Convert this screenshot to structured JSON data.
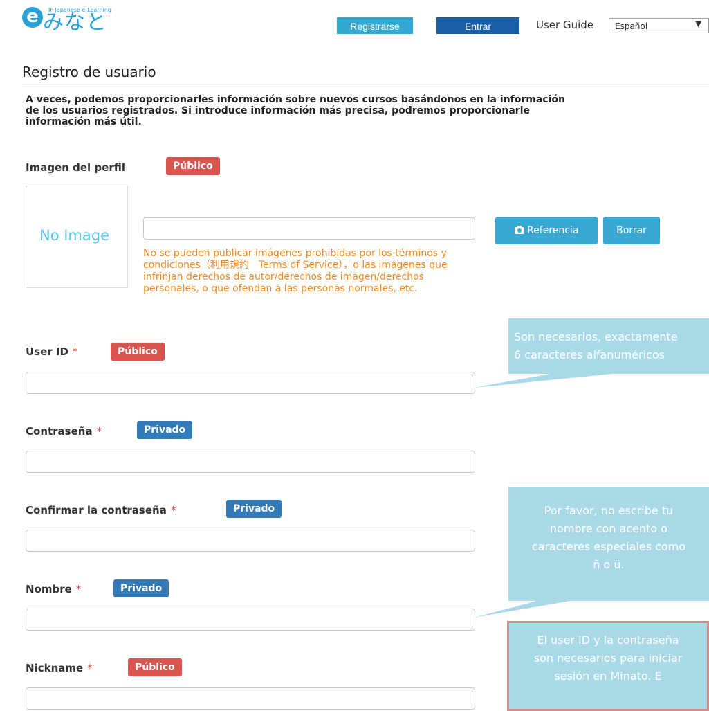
{
  "header": {
    "logo": {
      "subtitle": "JF Japanese e-Learning",
      "mark": "e",
      "name": "みなと"
    },
    "register_button": "Registrarse",
    "login_button": "Entrar",
    "user_guide": "User Guide",
    "language_select": "Español"
  },
  "page": {
    "title": "Registro de usuario",
    "intro": "A veces, podemos proporcionarles información sobre nuevos cursos basándonos en la información\nde los usuarios registrados. Si introduce información más precisa, podremos proporcionarle\ninformación más útil."
  },
  "profile_image": {
    "label": "Imagen del perfil",
    "badge": "Público",
    "placeholder_text": "No Image",
    "file_value": "",
    "browse_button": "Referencia",
    "delete_button": "Borrar",
    "warning": "No se pueden publicar imágenes prohibidas por los términos y condiciones（利用規約　Terms of Service），o las imágenes que infrinjan derechos de autor/derechos de imagen/derechos personales, o que ofendan a las personas normales, etc."
  },
  "fields": {
    "user_id": {
      "label": "User ID",
      "required": "*",
      "badge": "Público",
      "value": ""
    },
    "password": {
      "label": "Contraseña",
      "required": "*",
      "badge": "Privado",
      "value": ""
    },
    "confirm_password": {
      "label": "Confirmar la contraseña",
      "required": "*",
      "badge": "Privado",
      "value": ""
    },
    "name": {
      "label": "Nombre",
      "required": "*",
      "badge": "Privado",
      "value": ""
    },
    "nickname": {
      "label": "Nickname",
      "required": "*",
      "badge": "Público",
      "value": ""
    }
  },
  "tips": {
    "user_id": "Son necesarios, exactamente\n6 caracteres alfanuméricos",
    "name": "Por favor, no escribe tu\nnombre con acento o\ncaracteres especiales como\nñ o ü.",
    "login": "El user ID y la contraseña\nson necesarios para iniciar\nsesión en Minato. E"
  },
  "colors": {
    "brand": "#2aa0d8",
    "public_badge": "#d9534f",
    "private_badge": "#337ab7",
    "tooltip": "#a9d8e6",
    "warning_text": "#f08a1e"
  }
}
